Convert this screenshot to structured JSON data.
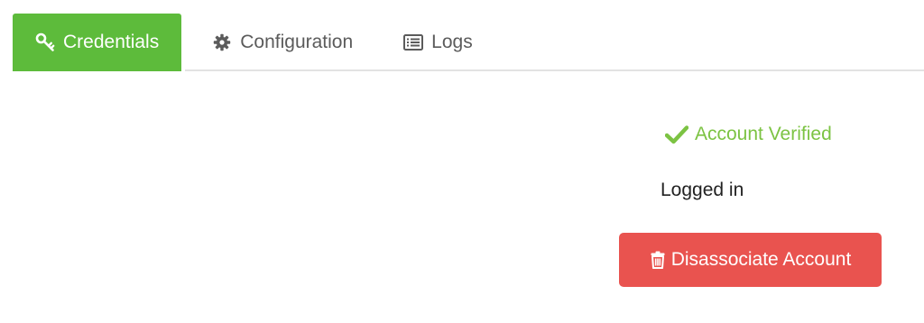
{
  "tabs": [
    {
      "label": "Credentials",
      "icon": "key-icon",
      "active": true
    },
    {
      "label": "Configuration",
      "icon": "gear-icon",
      "active": false
    },
    {
      "label": "Logs",
      "icon": "list-icon",
      "active": false
    }
  ],
  "status": {
    "verified_label": "Account Verified",
    "icon": "check-icon",
    "logged_in_label": "Logged in"
  },
  "actions": {
    "disassociate_label": "Disassociate Account",
    "icon": "trash-icon"
  },
  "colors": {
    "active_tab": "#5dbb3b",
    "verified": "#7cc343",
    "danger": "#e9534f"
  }
}
